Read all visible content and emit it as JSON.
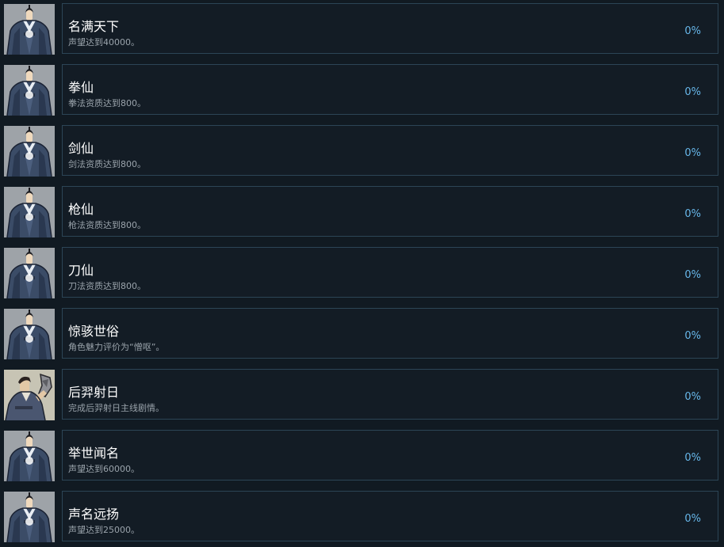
{
  "achievements": [
    {
      "title": "名满天下",
      "desc": "声望达到40000。",
      "percent": "0%",
      "icon": "robed-man-icon"
    },
    {
      "title": "拳仙",
      "desc": "拳法资质达到800。",
      "percent": "0%",
      "icon": "robed-man-icon"
    },
    {
      "title": "剑仙",
      "desc": "剑法资质达到800。",
      "percent": "0%",
      "icon": "robed-man-icon"
    },
    {
      "title": "枪仙",
      "desc": "枪法资质达到800。",
      "percent": "0%",
      "icon": "robed-man-icon"
    },
    {
      "title": "刀仙",
      "desc": "刀法资质达到800。",
      "percent": "0%",
      "icon": "robed-man-icon"
    },
    {
      "title": "惊骇世俗",
      "desc": "角色魅力评价为“憎呕”。",
      "percent": "0%",
      "icon": "robed-man-icon"
    },
    {
      "title": "后羿射日",
      "desc": "完成后羿射日主线剧情。",
      "percent": "0%",
      "icon": "archer-icon"
    },
    {
      "title": "举世闻名",
      "desc": "声望达到60000。",
      "percent": "0%",
      "icon": "robed-man-icon"
    },
    {
      "title": "声名远扬",
      "desc": "声望达到25000。",
      "percent": "0%",
      "icon": "robed-man-icon"
    }
  ]
}
